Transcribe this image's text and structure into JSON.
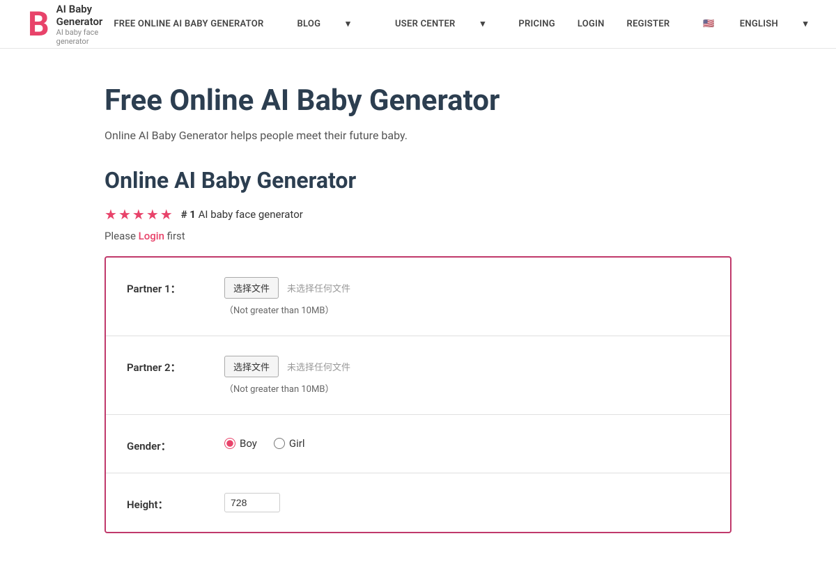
{
  "brand": {
    "letter": "B",
    "title": "AI Baby Generator",
    "subtitle": "AI baby face generator"
  },
  "nav": {
    "links": [
      {
        "id": "free-online",
        "label": "FREE ONLINE AI BABY GENERATOR",
        "has_caret": false
      },
      {
        "id": "blog",
        "label": "BLOG",
        "has_caret": true
      },
      {
        "id": "user-center",
        "label": "USER CENTER",
        "has_caret": true
      },
      {
        "id": "pricing",
        "label": "PRICING",
        "has_caret": false
      },
      {
        "id": "login",
        "label": "LOGIN",
        "has_caret": false
      },
      {
        "id": "register",
        "label": "REGISTER",
        "has_caret": false
      },
      {
        "id": "language",
        "label": "ENGLISH",
        "has_caret": true,
        "flag": "🇺🇸"
      }
    ]
  },
  "page": {
    "title": "Free Online AI Baby Generator",
    "subtitle": "Online AI Baby Generator helps people meet their future baby.",
    "section_title": "Online AI Baby Generator",
    "stars_count": 5,
    "rank_label": "# 1",
    "rank_suffix": "AI baby face generator",
    "login_prompt_pre": "Please ",
    "login_link": "Login",
    "login_prompt_post": " first"
  },
  "form": {
    "partner1": {
      "label": "Partner 1：",
      "file_btn": "选择文件",
      "file_no_chosen": "未选择任何文件",
      "hint": "（Not greater than 10MB）"
    },
    "partner2": {
      "label": "Partner 2：",
      "file_btn": "选择文件",
      "file_no_chosen": "未选择任何文件",
      "hint": "（Not greater than 10MB）"
    },
    "gender": {
      "label": "Gender：",
      "options": [
        {
          "value": "boy",
          "label": "Boy",
          "checked": true
        },
        {
          "value": "girl",
          "label": "Girl",
          "checked": false
        }
      ]
    },
    "height": {
      "label": "Height：",
      "value": "728"
    }
  }
}
